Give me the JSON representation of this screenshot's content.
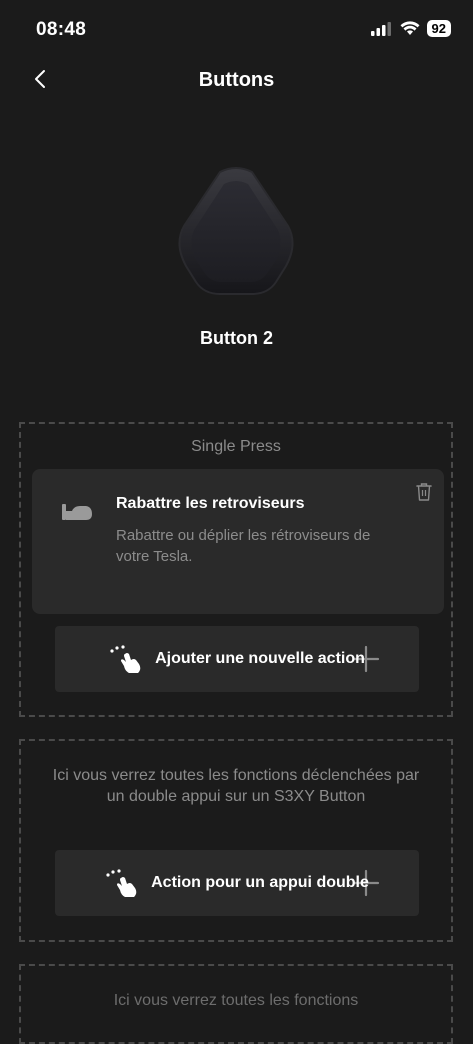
{
  "status": {
    "time": "08:48",
    "battery": "92"
  },
  "nav": {
    "title": "Buttons"
  },
  "device": {
    "name": "Button 2"
  },
  "single_press": {
    "title": "Single Press",
    "action": {
      "title": "Rabattre les retroviseurs",
      "description": "Rabattre ou déplier les rétroviseurs de votre Tesla."
    },
    "add_label": "Ajouter une nouvelle action"
  },
  "double_press": {
    "info": "Ici vous verrez toutes les fonctions déclenchées par un double appui sur un S3XY Button",
    "add_label": "Action pour un appui double"
  },
  "third_section": {
    "info": "Ici vous verrez toutes les fonctions"
  },
  "icons": {
    "back": "chevron-left-icon",
    "mirror": "side-mirror-icon",
    "trash": "trash-icon",
    "tap": "tap-gesture-icon",
    "plus": "plus-icon"
  },
  "colors": {
    "background": "#1b1b1b",
    "card": "#2a2a2a",
    "muted_text": "#8b8b8b",
    "border": "#4a4a4a"
  }
}
